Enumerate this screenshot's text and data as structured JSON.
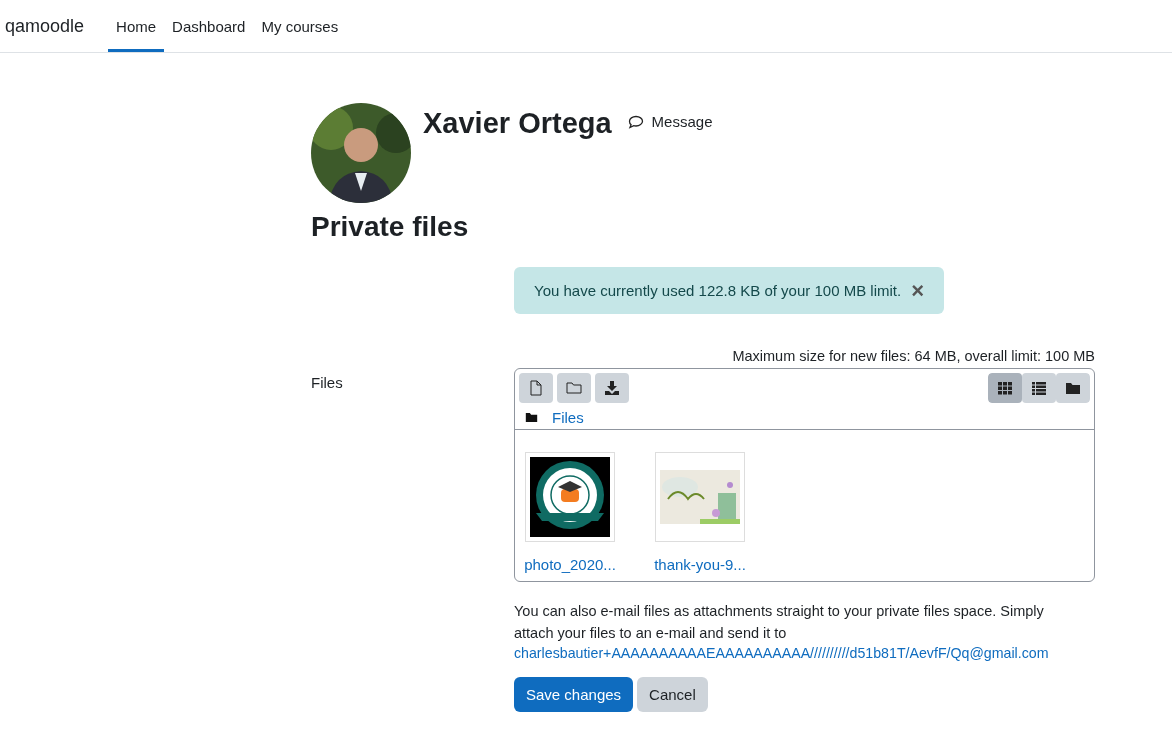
{
  "navbar": {
    "brand": "qamoodle",
    "items": [
      {
        "label": "Home",
        "selected": true
      },
      {
        "label": "Dashboard",
        "selected": false
      },
      {
        "label": "My courses",
        "selected": false
      }
    ]
  },
  "profile": {
    "name": "Xavier Ortega",
    "message_link": "Message"
  },
  "page_title": "Private files",
  "alert": {
    "text": "You have currently used 122.8 KB of your 100 MB limit.",
    "close": "×"
  },
  "files_field": {
    "label": "Files",
    "limits": "Maximum size for new files: 64 MB, overall limit: 100 MB",
    "toolbar": [
      {
        "kind": "file"
      },
      {
        "kind": "folder"
      },
      {
        "kind": "download"
      }
    ],
    "view_modes": [
      {
        "kind": "grid",
        "selected": true
      },
      {
        "kind": "list",
        "selected": false
      },
      {
        "kind": "tree",
        "selected": false
      }
    ],
    "breadcrumb": "Files",
    "files": [
      {
        "name": "photo_2020...",
        "kind": "picture"
      },
      {
        "name": "thank-you-9...",
        "kind": "picture"
      }
    ]
  },
  "email_note": {
    "text": "You can also e-mail files as attachments straight to your private files space. Simply attach your files to an e-mail and send it to",
    "address": "charlesbautier+AAAAAAAAAAEAAAAAAAAAA//////////d51b81T/AevfF/Qq@gmail.com"
  },
  "buttons": [
    {
      "label": "Save changes",
      "kind": "primary"
    },
    {
      "label": "Cancel",
      "kind": "secondary"
    }
  ]
}
